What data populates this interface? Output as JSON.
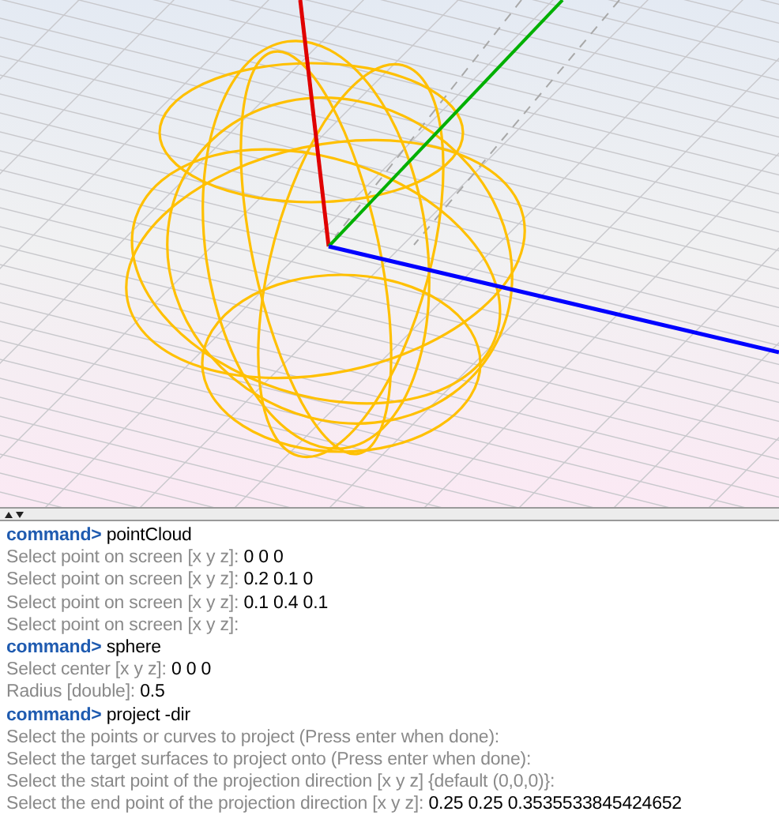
{
  "console": {
    "lines": [
      {
        "kind": "command",
        "prompt": "command>",
        "text": "pointCloud"
      },
      {
        "kind": "prompt",
        "text": "Select point on screen [x y z]:",
        "value": "0 0 0"
      },
      {
        "kind": "prompt",
        "text": "Select point on screen [x y z]:",
        "value": "0.2 0.1 0"
      },
      {
        "kind": "prompt",
        "text": "Select point on screen [x y z]:",
        "value": "0.1 0.4 0.1"
      },
      {
        "kind": "prompt",
        "text": "Select point on screen [x y z]:"
      },
      {
        "kind": "command",
        "prompt": "command>",
        "text": "sphere"
      },
      {
        "kind": "prompt",
        "text": "Select center [x y z]:",
        "value": "0 0 0"
      },
      {
        "kind": "prompt",
        "text": "Radius [double]:",
        "value": "0.5"
      },
      {
        "kind": "command",
        "prompt": "command>",
        "text": "project -dir"
      },
      {
        "kind": "prompt",
        "text": "Select the points or curves to project (Press enter when done):"
      },
      {
        "kind": "prompt",
        "text": "Select the target surfaces to project onto (Press enter when done):"
      },
      {
        "kind": "prompt",
        "text": "Select the start point of the projection direction [x y z] {default (0,0,0)}:"
      },
      {
        "kind": "prompt",
        "text": "Select the end point of the projection direction [x y z]:",
        "value": "0.25 0.25 0.3535533845424652"
      }
    ]
  }
}
